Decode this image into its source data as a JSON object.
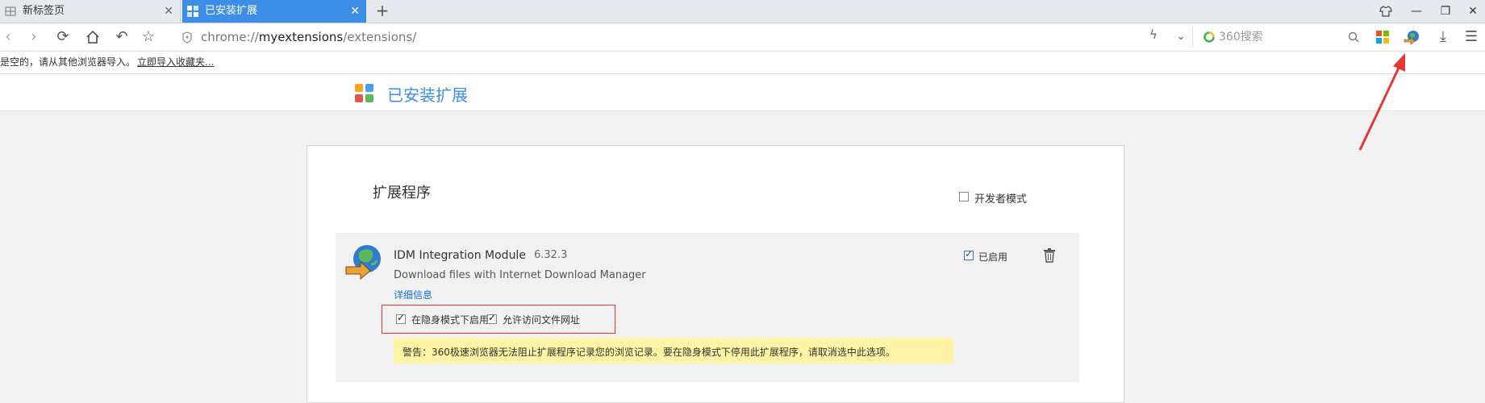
{
  "tabs": [
    {
      "label": "新标签页",
      "active": false
    },
    {
      "label": "已安装扩展",
      "active": true
    }
  ],
  "address_bar": {
    "prefix": "chrome://",
    "host": "myextensions",
    "path": "/extensions/"
  },
  "search": {
    "placeholder": "360搜索"
  },
  "bookmark_bar": {
    "message": "是空的，请从其他浏览器导入。",
    "import_link": "立即导入收藏夹..."
  },
  "page_header": {
    "title": "已安装扩展"
  },
  "extensions_panel": {
    "title": "扩展程序",
    "developer_mode_label": "开发者模式",
    "developer_mode_checked": false
  },
  "extension": {
    "name": "IDM Integration Module",
    "version": "6.32.3",
    "description": "Download files with Internet Download Manager",
    "details_link": "详细信息",
    "incognito_label": "在隐身模式下启用",
    "incognito_checked": true,
    "file_access_label": "允许访问文件网址",
    "file_access_checked": true,
    "enabled_label": "已启用",
    "enabled_checked": true,
    "warning": "警告：360极速浏览器无法阻止扩展程序记录您的浏览记录。要在隐身模式下停用此扩展程序，请取消选中此选项。"
  },
  "colors": {
    "accent_blue": "#3d8ee6",
    "warning_bg": "#fff3a6",
    "annotation_red": "#e53935"
  }
}
